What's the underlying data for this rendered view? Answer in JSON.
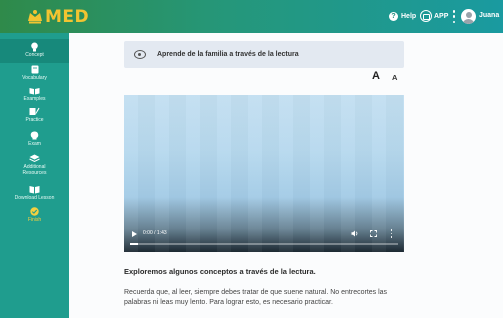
{
  "header": {
    "logo_text": "MED",
    "help_label": "Help",
    "app_label": "APP",
    "user_name": "Juana",
    "colors": {
      "logo": "#f2c431",
      "bar_start": "#2f8a4a",
      "bar_end": "#1a9aa0"
    }
  },
  "sidebar": {
    "items": [
      {
        "label": "Concept",
        "icon": "lightbulb-icon",
        "active": true
      },
      {
        "label": "Vocabulary",
        "icon": "book-icon"
      },
      {
        "label": "Examples",
        "icon": "open-book-icon"
      },
      {
        "label": "Practice",
        "icon": "pencil-icon"
      },
      {
        "label": "Exam",
        "icon": "brain-icon"
      },
      {
        "label": "Additional Resources",
        "icon": "layers-icon"
      },
      {
        "label": "Download Lesson",
        "icon": "download-book-icon"
      },
      {
        "label": "Finish",
        "icon": "check-circle-icon"
      }
    ],
    "colors": {
      "background": "#1f9d8e",
      "finish": "#f4d03f"
    }
  },
  "main": {
    "title": "Aprende de la familia a través de la lectura",
    "font_large_label": "A",
    "font_small_label": "A",
    "video": {
      "time": "0:00 / 1:43",
      "progress": 0.03
    },
    "subtitle": "Exploremos algunos conceptos a través de la lectura.",
    "paragraph": "Recuerda que, al leer, siempre debes tratar de que suene natural. No entrecortes las palabras ni leas muy lento. Para lograr esto, es necesario practicar."
  }
}
